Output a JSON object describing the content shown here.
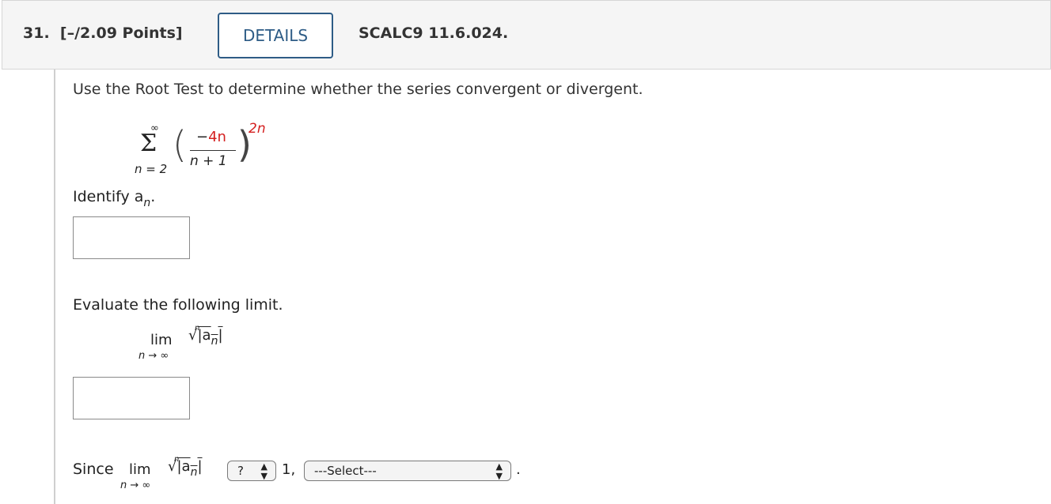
{
  "header": {
    "question_number": "31.",
    "points": "[–/2.09 Points]",
    "details_button": "DETAILS",
    "problem_code": "SCALC9 11.6.024."
  },
  "problem": {
    "prompt": "Use the Root Test to determine whether the series convergent or divergent.",
    "series": {
      "upper_limit": "∞",
      "lower_limit": "n = 2",
      "numerator": "−4n",
      "denominator": "n + 1",
      "exponent": "2n"
    },
    "identify_label": "Identify a",
    "identify_subscript": "n",
    "identify_end": ".",
    "evaluate_label": "Evaluate the following limit.",
    "limit_word": "lim",
    "limit_sub": "n → ∞",
    "root_index": "n",
    "abs_open": "|a",
    "abs_sub": "n",
    "abs_close": "|",
    "since_label": "Since",
    "compare_select": "?",
    "one_label": "1,",
    "conclusion_select": "---Select---",
    "period": "."
  },
  "answers": {
    "an_value": "",
    "limit_value": ""
  },
  "colors": {
    "accent": "#2e5c86",
    "highlight_red": "#d42020",
    "header_bg": "#f5f5f5"
  }
}
